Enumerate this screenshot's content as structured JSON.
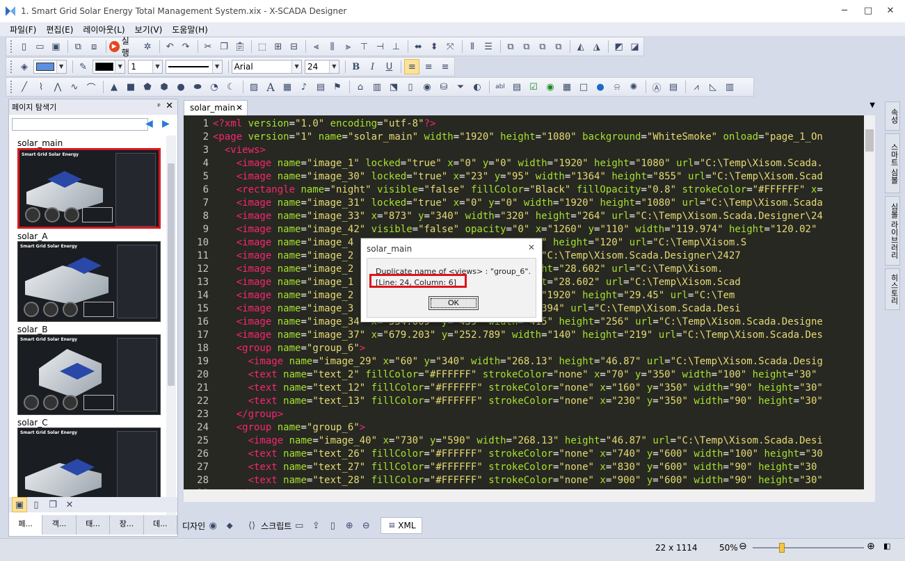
{
  "window": {
    "title": "1. Smart Grid Solar Energy Total Management System.xix - X-SCADA Designer",
    "controls": [
      "─",
      "□",
      "✕"
    ]
  },
  "menu": [
    "파일(F)",
    "편집(E)",
    "레이아웃(L)",
    "보기(V)",
    "도움말(H)"
  ],
  "toolbar": {
    "run_label": "실행",
    "line_width_value": "1",
    "font_value": "Arial",
    "font_size_value": "24",
    "bold": "B",
    "italic": "I",
    "underline": "U"
  },
  "left_panel": {
    "title": "페이지 탐색기",
    "pin": "ᵖ",
    "close": "✕",
    "search_placeholder": "",
    "pages": [
      {
        "name": "solar_main",
        "selected": true,
        "header": "Smart Grid Solar Energy"
      },
      {
        "name": "solar_A",
        "selected": false,
        "header": "Smart Grid Solar Energy"
      },
      {
        "name": "solar_B",
        "selected": false,
        "header": "Smart Grid Solar Energy"
      },
      {
        "name": "solar_C",
        "selected": false,
        "header": "Smart Grid Solar Energy"
      }
    ],
    "tabs": [
      "페...",
      "객...",
      "태...",
      "장...",
      "데..."
    ]
  },
  "editor": {
    "tab_label": "solar_main",
    "tab_close": "✕",
    "lines": [
      {
        "n": "1",
        "html": "<span class=\"tag\">&lt;?xml</span> <span class=\"attr\">version</span>=<span class=\"str\">\"1.0\"</span> <span class=\"attr\">encoding</span>=<span class=\"str\">\"utf-8\"</span><span class=\"tag\">?&gt;</span>"
      },
      {
        "n": "2",
        "html": "<span class=\"tag\">&lt;page</span> <span class=\"attr\">version</span>=<span class=\"str\">\"1\"</span> <span class=\"attr\">name</span>=<span class=\"str\">\"solar_main\"</span> <span class=\"attr\">width</span>=<span class=\"str\">\"1920\"</span> <span class=\"attr\">height</span>=<span class=\"str\">\"1080\"</span> <span class=\"attr\">background</span>=<span class=\"str\">\"WhiteSmoke\"</span> <span class=\"attr\">onload</span>=<span class=\"str\">\"page_1_On</span>"
      },
      {
        "n": "3",
        "html": "  <span class=\"tag\">&lt;views&gt;</span>"
      },
      {
        "n": "4",
        "html": "    <span class=\"tag\">&lt;image</span> <span class=\"attr\">name</span>=<span class=\"str\">\"image_1\"</span> <span class=\"attr\">locked</span>=<span class=\"str\">\"true\"</span> <span class=\"attr\">x</span>=<span class=\"str\">\"0\"</span> <span class=\"attr\">y</span>=<span class=\"str\">\"0\"</span> <span class=\"attr\">width</span>=<span class=\"str\">\"1920\"</span> <span class=\"attr\">height</span>=<span class=\"str\">\"1080\"</span> <span class=\"attr\">url</span>=<span class=\"str\">\"C:\\Temp\\Xisom.Scada.</span>"
      },
      {
        "n": "5",
        "html": "    <span class=\"tag\">&lt;image</span> <span class=\"attr\">name</span>=<span class=\"str\">\"image_30\"</span> <span class=\"attr\">locked</span>=<span class=\"str\">\"true\"</span> <span class=\"attr\">x</span>=<span class=\"str\">\"23\"</span> <span class=\"attr\">y</span>=<span class=\"str\">\"95\"</span> <span class=\"attr\">width</span>=<span class=\"str\">\"1364\"</span> <span class=\"attr\">height</span>=<span class=\"str\">\"855\"</span> <span class=\"attr\">url</span>=<span class=\"str\">\"C:\\Temp\\Xisom.Scad</span>"
      },
      {
        "n": "6",
        "html": "    <span class=\"tag\">&lt;rectangle</span> <span class=\"attr\">name</span>=<span class=\"str\">\"night\"</span> <span class=\"attr\">visible</span>=<span class=\"str\">\"false\"</span> <span class=\"attr\">fillColor</span>=<span class=\"str\">\"Black\"</span> <span class=\"attr\">fillOpacity</span>=<span class=\"str\">\"0.8\"</span> <span class=\"attr\">strokeColor</span>=<span class=\"str\">\"#FFFFFF\"</span> <span class=\"attr\">x</span>="
      },
      {
        "n": "7",
        "html": "    <span class=\"tag\">&lt;image</span> <span class=\"attr\">name</span>=<span class=\"str\">\"image_31\"</span> <span class=\"attr\">locked</span>=<span class=\"str\">\"true\"</span> <span class=\"attr\">x</span>=<span class=\"str\">\"0\"</span> <span class=\"attr\">y</span>=<span class=\"str\">\"0\"</span> <span class=\"attr\">width</span>=<span class=\"str\">\"1920\"</span> <span class=\"attr\">height</span>=<span class=\"str\">\"1080\"</span> <span class=\"attr\">url</span>=<span class=\"str\">\"C:\\Temp\\Xisom.Scada</span>"
      },
      {
        "n": "8",
        "html": "    <span class=\"tag\">&lt;image</span> <span class=\"attr\">name</span>=<span class=\"str\">\"image_33\"</span> <span class=\"attr\">x</span>=<span class=\"str\">\"873\"</span> <span class=\"attr\">y</span>=<span class=\"str\">\"340\"</span> <span class=\"attr\">width</span>=<span class=\"str\">\"320\"</span> <span class=\"attr\">height</span>=<span class=\"str\">\"264\"</span> <span class=\"attr\">url</span>=<span class=\"str\">\"C:\\Temp\\Xisom.Scada.Designer\\24</span>"
      },
      {
        "n": "9",
        "html": "    <span class=\"tag\">&lt;image</span> <span class=\"attr\">name</span>=<span class=\"str\">\"image_42\"</span> <span class=\"attr\">visible</span>=<span class=\"str\">\"false\"</span> <span class=\"attr\">opacity</span>=<span class=\"str\">\"0\"</span> <span class=\"attr\">x</span>=<span class=\"str\">\"1260\"</span> <span class=\"attr\">y</span>=<span class=\"str\">\"110\"</span> <span class=\"attr\">width</span>=<span class=\"str\">\"119.974\"</span> <span class=\"attr\">height</span>=<span class=\"str\">\"120.02\"</span>"
      },
      {
        "n": "10",
        "html": "    <span class=\"tag\">&lt;image</span> <span class=\"attr\">name</span>=<span class=\"str\">\"image_4</span>                 <span class=\"str\">\"20\"</span> <span class=\"attr\">width</span>=<span class=\"str\">\"120\"</span> <span class=\"attr\">height</span>=<span class=\"str\">\"120\"</span> <span class=\"attr\">url</span>=<span class=\"str\">\"C:\\Temp\\Xisom.S</span>"
      },
      {
        "n": "11",
        "html": "    <span class=\"tag\">&lt;image</span> <span class=\"attr\">name</span>=<span class=\"str\">\"image_2</span>               <span class=\"attr\">ight</span>=<span class=\"str\">\"70.58\"</span> <span class=\"attr\">url</span>=<span class=\"str\">\"C:\\Temp\\Xisom.Scada.Designer\\2427</span>"
      },
      {
        "n": "12",
        "html": "    <span class=\"tag\">&lt;image</span> <span class=\"attr\">name</span>=<span class=\"str\">\"image_2</span>               <span class=\"attr\">dth</span>=<span class=\"str\">\"518.26\"</span> <span class=\"attr\">height</span>=<span class=\"str\">\"28.602\"</span> <span class=\"attr\">url</span>=<span class=\"str\">\"C:\\Temp\\Xisom.</span>"
      },
      {
        "n": "13",
        "html": "    <span class=\"tag\">&lt;image</span> <span class=\"attr\">name</span>=<span class=\"str\">\"image_1</span>               <span class=\"attr\">dth</span>=<span class=\"str\">\"1.048\"</span> <span class=\"attr\">height</span>=<span class=\"str\">\"28.602\"</span> <span class=\"attr\">url</span>=<span class=\"str\">\"C:\\Temp\\Xisom.Scad</span>"
      },
      {
        "n": "14",
        "html": "    <span class=\"tag\">&lt;image</span> <span class=\"attr\">name</span>=<span class=\"str\">\"image_2</span>               <span class=\"str\">\"1051.667\"</span> <span class=\"attr\">width</span>=<span class=\"str\">\"1920\"</span> <span class=\"attr\">height</span>=<span class=\"str\">\"29.45\"</span> <span class=\"attr\">url</span>=<span class=\"str\">\"C:\\Tem</span>"
      },
      {
        "n": "15",
        "html": "    <span class=\"tag\">&lt;image</span> <span class=\"attr\">name</span>=<span class=\"str\">\"image_3</span>               <span class=\"attr\">th</span>=<span class=\"str\">\"370\"</span> <span class=\"attr\">height</span>=<span class=\"str\">\"394\"</span> <span class=\"attr\">url</span>=<span class=\"str\">\"C:\\Temp\\Xisom.Scada.Desi</span>"
      },
      {
        "n": "16",
        "html": "    <span class=\"tag\">&lt;image</span> <span class=\"attr\">name</span>=<span class=\"str\">\"image_34\"</span> <span class=\"attr\">x</span>=<span class=\"str\">\"534.669\"</span> <span class=\"attr\">y</span>=<span class=\"str\">\"439\"</span> <span class=\"attr\">width</span>=<span class=\"str\">\"415\"</span> <span class=\"attr\">height</span>=<span class=\"str\">\"256\"</span> <span class=\"attr\">url</span>=<span class=\"str\">\"C:\\Temp\\Xisom.Scada.Designe</span>"
      },
      {
        "n": "17",
        "html": "    <span class=\"tag\">&lt;image</span> <span class=\"attr\">name</span>=<span class=\"str\">\"image_37\"</span> <span class=\"attr\">x</span>=<span class=\"str\">\"679.203\"</span> <span class=\"attr\">y</span>=<span class=\"str\">\"252.789\"</span> <span class=\"attr\">width</span>=<span class=\"str\">\"140\"</span> <span class=\"attr\">height</span>=<span class=\"str\">\"219\"</span> <span class=\"attr\">url</span>=<span class=\"str\">\"C:\\Temp\\Xisom.Scada.Des</span>"
      },
      {
        "n": "18",
        "html": "    <span class=\"tag\">&lt;group</span> <span class=\"attr\">name</span>=<span class=\"str\">\"group_6\"</span><span class=\"tag\">&gt;</span>"
      },
      {
        "n": "19",
        "html": "      <span class=\"tag\">&lt;image</span> <span class=\"attr\">name</span>=<span class=\"str\">\"image_29\"</span> <span class=\"attr\">x</span>=<span class=\"str\">\"60\"</span> <span class=\"attr\">y</span>=<span class=\"str\">\"340\"</span> <span class=\"attr\">width</span>=<span class=\"str\">\"268.13\"</span> <span class=\"attr\">height</span>=<span class=\"str\">\"46.87\"</span> <span class=\"attr\">url</span>=<span class=\"str\">\"C:\\Temp\\Xisom.Scada.Desig</span>"
      },
      {
        "n": "20",
        "html": "      <span class=\"tag\">&lt;text</span> <span class=\"attr\">name</span>=<span class=\"str\">\"text_2\"</span> <span class=\"attr\">fillColor</span>=<span class=\"str\">\"#FFFFFF\"</span> <span class=\"attr\">strokeColor</span>=<span class=\"str\">\"none\"</span> <span class=\"attr\">x</span>=<span class=\"str\">\"70\"</span> <span class=\"attr\">y</span>=<span class=\"str\">\"350\"</span> <span class=\"attr\">width</span>=<span class=\"str\">\"100\"</span> <span class=\"attr\">height</span>=<span class=\"str\">\"30\"</span>"
      },
      {
        "n": "21",
        "html": "      <span class=\"tag\">&lt;text</span> <span class=\"attr\">name</span>=<span class=\"str\">\"text_12\"</span> <span class=\"attr\">fillColor</span>=<span class=\"str\">\"#FFFFFF\"</span> <span class=\"attr\">strokeColor</span>=<span class=\"str\">\"none\"</span> <span class=\"attr\">x</span>=<span class=\"str\">\"160\"</span> <span class=\"attr\">y</span>=<span class=\"str\">\"350\"</span> <span class=\"attr\">width</span>=<span class=\"str\">\"90\"</span> <span class=\"attr\">height</span>=<span class=\"str\">\"30\"</span>"
      },
      {
        "n": "22",
        "html": "      <span class=\"tag\">&lt;text</span> <span class=\"attr\">name</span>=<span class=\"str\">\"text_13\"</span> <span class=\"attr\">fillColor</span>=<span class=\"str\">\"#FFFFFF\"</span> <span class=\"attr\">strokeColor</span>=<span class=\"str\">\"none\"</span> <span class=\"attr\">x</span>=<span class=\"str\">\"230\"</span> <span class=\"attr\">y</span>=<span class=\"str\">\"350\"</span> <span class=\"attr\">width</span>=<span class=\"str\">\"90\"</span> <span class=\"attr\">height</span>=<span class=\"str\">\"30\"</span>"
      },
      {
        "n": "23",
        "html": "    <span class=\"tag\">&lt;/group&gt;</span>"
      },
      {
        "n": "24",
        "html": "    <span class=\"tag\">&lt;group</span> <span class=\"attr\">name</span>=<span class=\"str\">\"group_6\"</span><span class=\"tag\">&gt;</span>"
      },
      {
        "n": "25",
        "html": "      <span class=\"tag\">&lt;image</span> <span class=\"attr\">name</span>=<span class=\"str\">\"image_40\"</span> <span class=\"attr\">x</span>=<span class=\"str\">\"730\"</span> <span class=\"attr\">y</span>=<span class=\"str\">\"590\"</span> <span class=\"attr\">width</span>=<span class=\"str\">\"268.13\"</span> <span class=\"attr\">height</span>=<span class=\"str\">\"46.87\"</span> <span class=\"attr\">url</span>=<span class=\"str\">\"C:\\Temp\\Xisom.Scada.Desi</span>"
      },
      {
        "n": "26",
        "html": "      <span class=\"tag\">&lt;text</span> <span class=\"attr\">name</span>=<span class=\"str\">\"text_26\"</span> <span class=\"attr\">fillColor</span>=<span class=\"str\">\"#FFFFFF\"</span> <span class=\"attr\">strokeColor</span>=<span class=\"str\">\"none\"</span> <span class=\"attr\">x</span>=<span class=\"str\">\"740\"</span> <span class=\"attr\">y</span>=<span class=\"str\">\"600\"</span> <span class=\"attr\">width</span>=<span class=\"str\">\"100\"</span> <span class=\"attr\">height</span>=<span class=\"str\">\"30</span>"
      },
      {
        "n": "27",
        "html": "      <span class=\"tag\">&lt;text</span> <span class=\"attr\">name</span>=<span class=\"str\">\"text_27\"</span> <span class=\"attr\">fillColor</span>=<span class=\"str\">\"#FFFFFF\"</span> <span class=\"attr\">strokeColor</span>=<span class=\"str\">\"none\"</span> <span class=\"attr\">x</span>=<span class=\"str\">\"830\"</span> <span class=\"attr\">y</span>=<span class=\"str\">\"600\"</span> <span class=\"attr\">width</span>=<span class=\"str\">\"90\"</span> <span class=\"attr\">height</span>=<span class=\"str\">\"30</span>"
      },
      {
        "n": "28",
        "html": "      <span class=\"tag\">&lt;text</span> <span class=\"attr\">name</span>=<span class=\"str\">\"text_28\"</span> <span class=\"attr\">fillColor</span>=<span class=\"str\">\"#FFFFFF\"</span> <span class=\"attr\">strokeColor</span>=<span class=\"str\">\"none\"</span> <span class=\"attr\">x</span>=<span class=\"str\">\"900\"</span> <span class=\"attr\">y</span>=<span class=\"str\">\"600\"</span> <span class=\"attr\">width</span>=<span class=\"str\">\"90\"</span> <span class=\"attr\">height</span>=<span class=\"str\">\"30\"</span>"
      },
      {
        "n": "29",
        "html": "    <span class=\"tag\">&lt;/group&gt;</span>"
      }
    ]
  },
  "bottom_tabs": {
    "design": "디자인",
    "script": "스크립트",
    "xml": "XML"
  },
  "right_dock": [
    "속성",
    "스마트 심볼",
    "심볼 라이브러리",
    "히스토리"
  ],
  "dialog": {
    "title": "solar_main",
    "close": "✕",
    "message": "Duplicate name of <views> : \"group_6\".",
    "position": "[Line: 24, Column: 6]",
    "ok": "OK"
  },
  "status": {
    "coords": "22 x 1114",
    "zoom": "50%",
    "zoom_fraction": 0.1
  },
  "colors": {
    "highlight_red": "#e0131b",
    "editor_bg": "#272822",
    "tag": "#f92672",
    "attr": "#a6e22e",
    "string": "#e6db74"
  }
}
